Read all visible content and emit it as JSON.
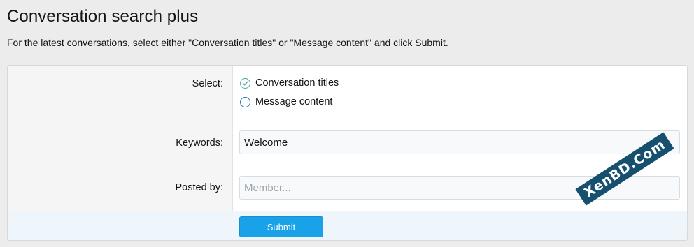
{
  "page": {
    "title": "Conversation search plus",
    "description": "For the latest conversations, select either \"Conversation titles\" or \"Message content\" and click Submit."
  },
  "form": {
    "select_label": "Select:",
    "options": [
      {
        "label": "Conversation titles",
        "checked": true
      },
      {
        "label": "Message content",
        "checked": false
      }
    ],
    "keywords_label": "Keywords:",
    "keywords_value": "Welcome",
    "posted_by_label": "Posted by:",
    "posted_by_placeholder": "Member...",
    "submit_label": "Submit"
  },
  "colors": {
    "accent": "#1aa2e8",
    "checked_radio": "#47a7a3",
    "unchecked_radio": "#2577b1"
  },
  "watermark": {
    "text": "XenBD.Com"
  }
}
